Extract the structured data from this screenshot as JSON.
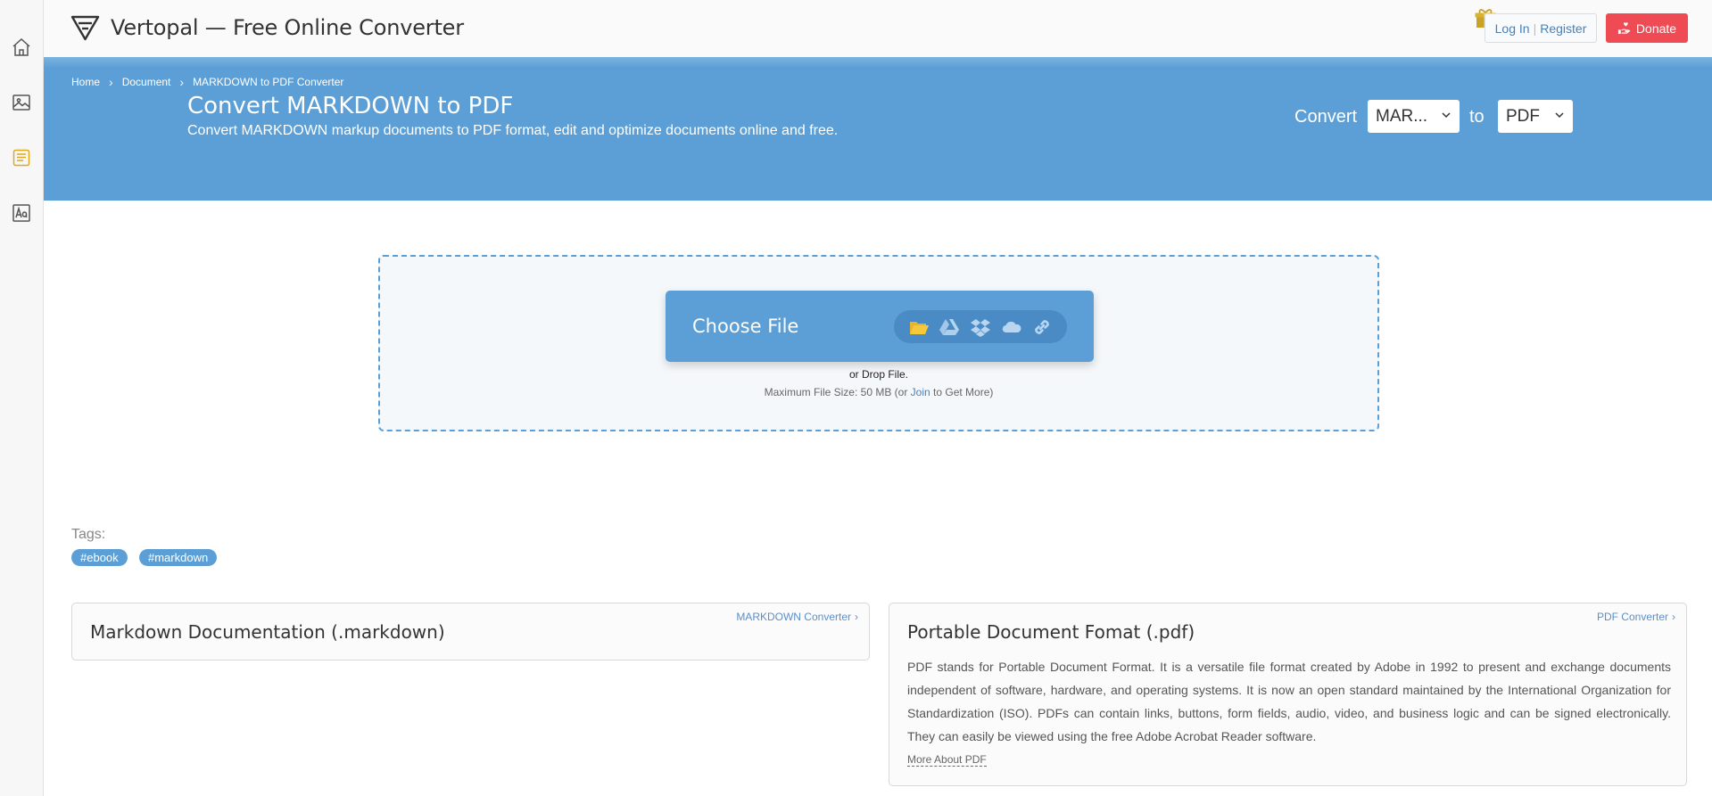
{
  "app": {
    "title": "Vertopal — Free Online Converter"
  },
  "header": {
    "login_label": "Log In",
    "separator": "|",
    "register_label": "Register",
    "donate_label": "Donate"
  },
  "sidebar": {
    "items": [
      {
        "name": "home-icon"
      },
      {
        "name": "image-icon"
      },
      {
        "name": "document-icon",
        "active": true
      },
      {
        "name": "font-icon"
      }
    ]
  },
  "breadcrumb": {
    "items": [
      "Home",
      "Document",
      "MARKDOWN to PDF Converter"
    ]
  },
  "hero": {
    "title": "Convert MARKDOWN to PDF",
    "subtitle": "Convert MARKDOWN markup documents to PDF format, edit and optimize documents online and free.",
    "convert_label": "Convert",
    "from_value": "MAR...",
    "to_label": "to",
    "to_value": "PDF"
  },
  "upload": {
    "choose_label": "Choose File",
    "sources": [
      "folder-icon",
      "google-drive-icon",
      "dropbox-icon",
      "onedrive-icon",
      "link-icon"
    ],
    "drop_text": "or Drop File.",
    "max_prefix": "Maximum File Size: 50 MB (or ",
    "join_label": "Join",
    "max_suffix": " to Get More)"
  },
  "tags": {
    "label": "Tags:",
    "items": [
      "#ebook",
      "#markdown"
    ]
  },
  "cards": {
    "left": {
      "link": "MARKDOWN Converter",
      "title": "Markdown Documentation (.markdown)"
    },
    "right": {
      "link": "PDF Converter",
      "title": "Portable Document Fomat (.pdf)",
      "body": "PDF stands for Portable Document Format. It is a versatile file format created by Adobe in 1992 to present and exchange documents independent of software, hardware, and operating systems. It is now an open standard maintained by the International Organization for Standardization (ISO). PDFs can contain links, buttons, form fields, audio, video, and business logic and can be signed electronically. They can easily be viewed using the free Adobe Acrobat Reader software.",
      "more": "More About PDF"
    }
  },
  "colors": {
    "accent": "#5c9fd6",
    "donate": "#ee4b55",
    "active_icon": "#e0a91c"
  }
}
